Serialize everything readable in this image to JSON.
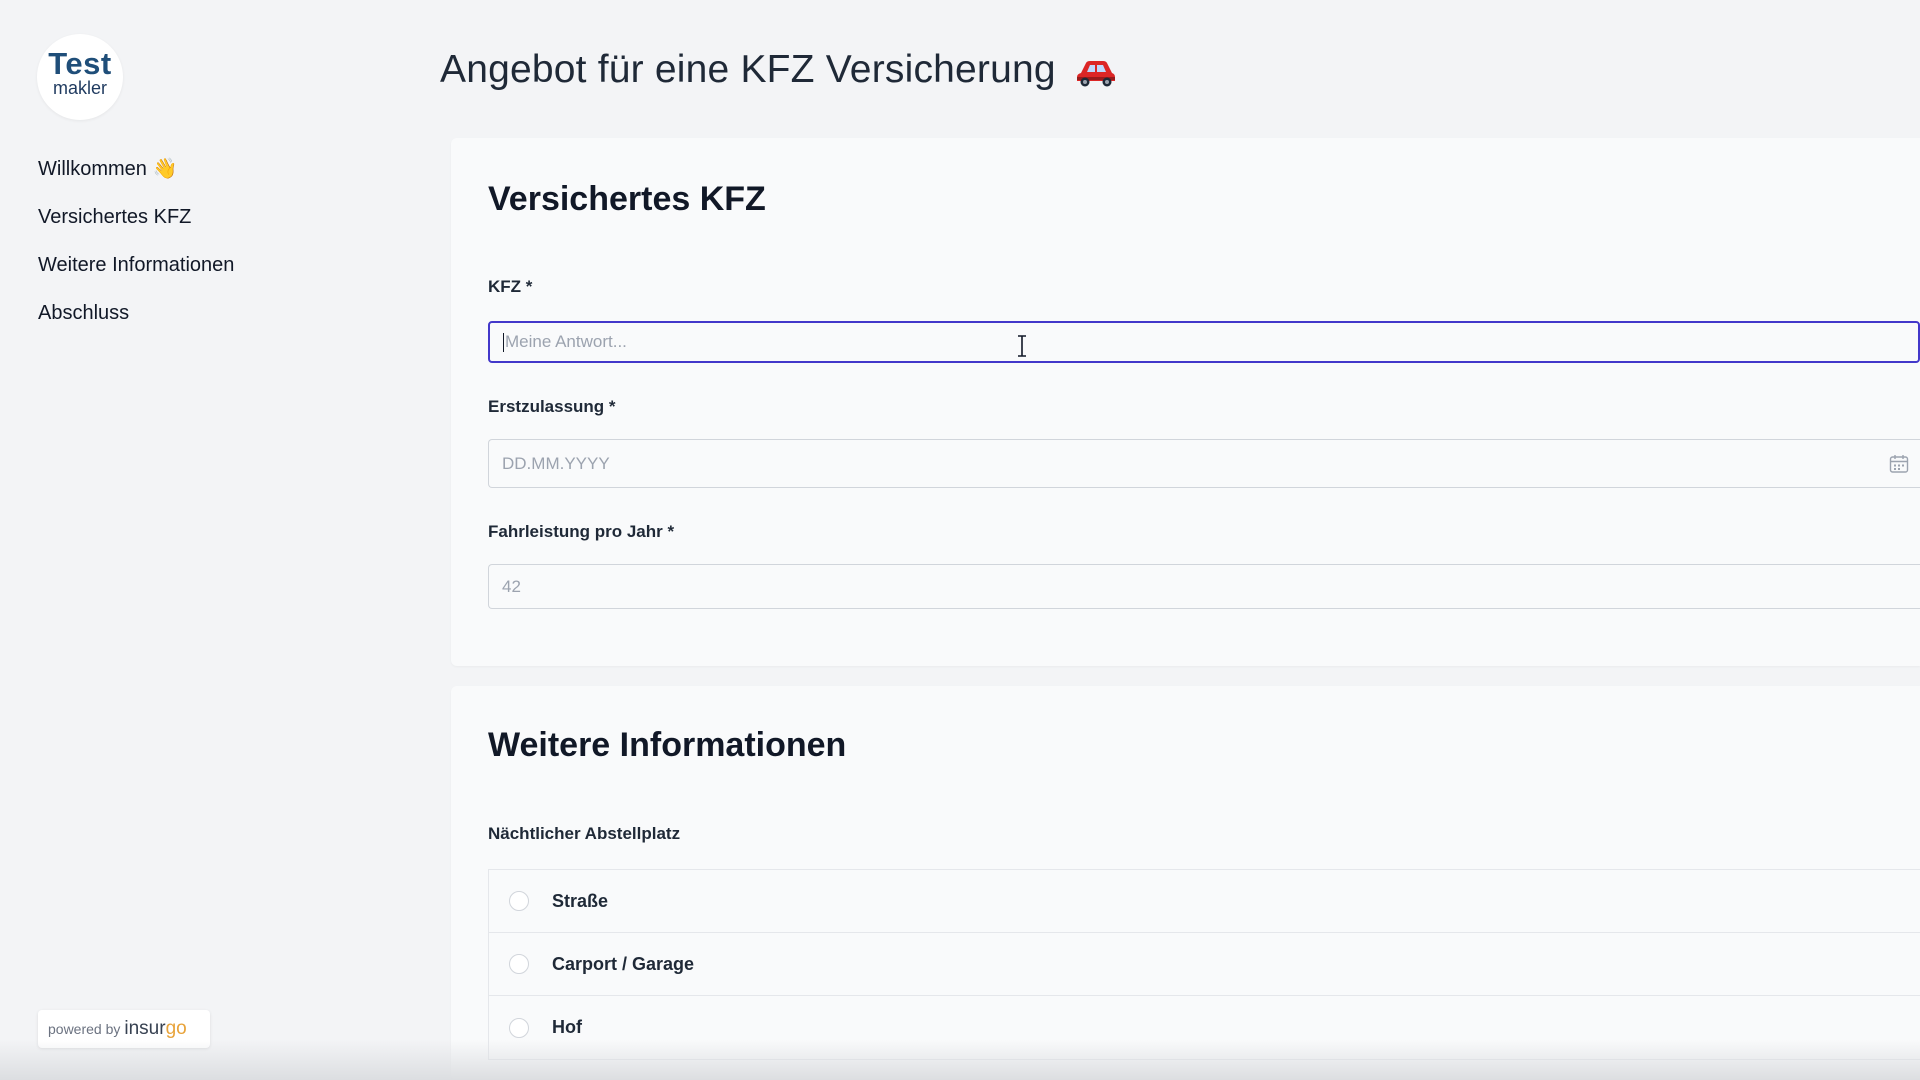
{
  "sidebar": {
    "logo": {
      "line1": "Test",
      "line2": "makler"
    },
    "nav": [
      {
        "label": "Willkommen 👋"
      },
      {
        "label": "Versichertes KFZ"
      },
      {
        "label": "Weitere Informationen"
      },
      {
        "label": "Abschluss"
      }
    ],
    "powered_by": {
      "prefix": "powered by",
      "brand_a": "insur",
      "brand_b": "go"
    }
  },
  "header": {
    "title": "Angebot für eine KFZ Versicherung"
  },
  "sections": {
    "vehicle": {
      "title": "Versichertes KFZ",
      "fields": {
        "kfz": {
          "label": "KFZ *",
          "placeholder": "Meine Antwort..."
        },
        "erstzulassung": {
          "label": "Erstzulassung *",
          "placeholder": "DD.MM.YYYY"
        },
        "fahrleistung": {
          "label": "Fahrleistung pro Jahr *",
          "placeholder": "42"
        }
      }
    },
    "more": {
      "title": "Weitere Informationen",
      "parking": {
        "label": "Nächtlicher Abstellplatz",
        "options": [
          "Straße",
          "Carport / Garage",
          "Hof"
        ]
      }
    }
  },
  "colors": {
    "accent": "#4338ca",
    "brand_go": "#e8a33a",
    "logo": "#1f4e79"
  }
}
